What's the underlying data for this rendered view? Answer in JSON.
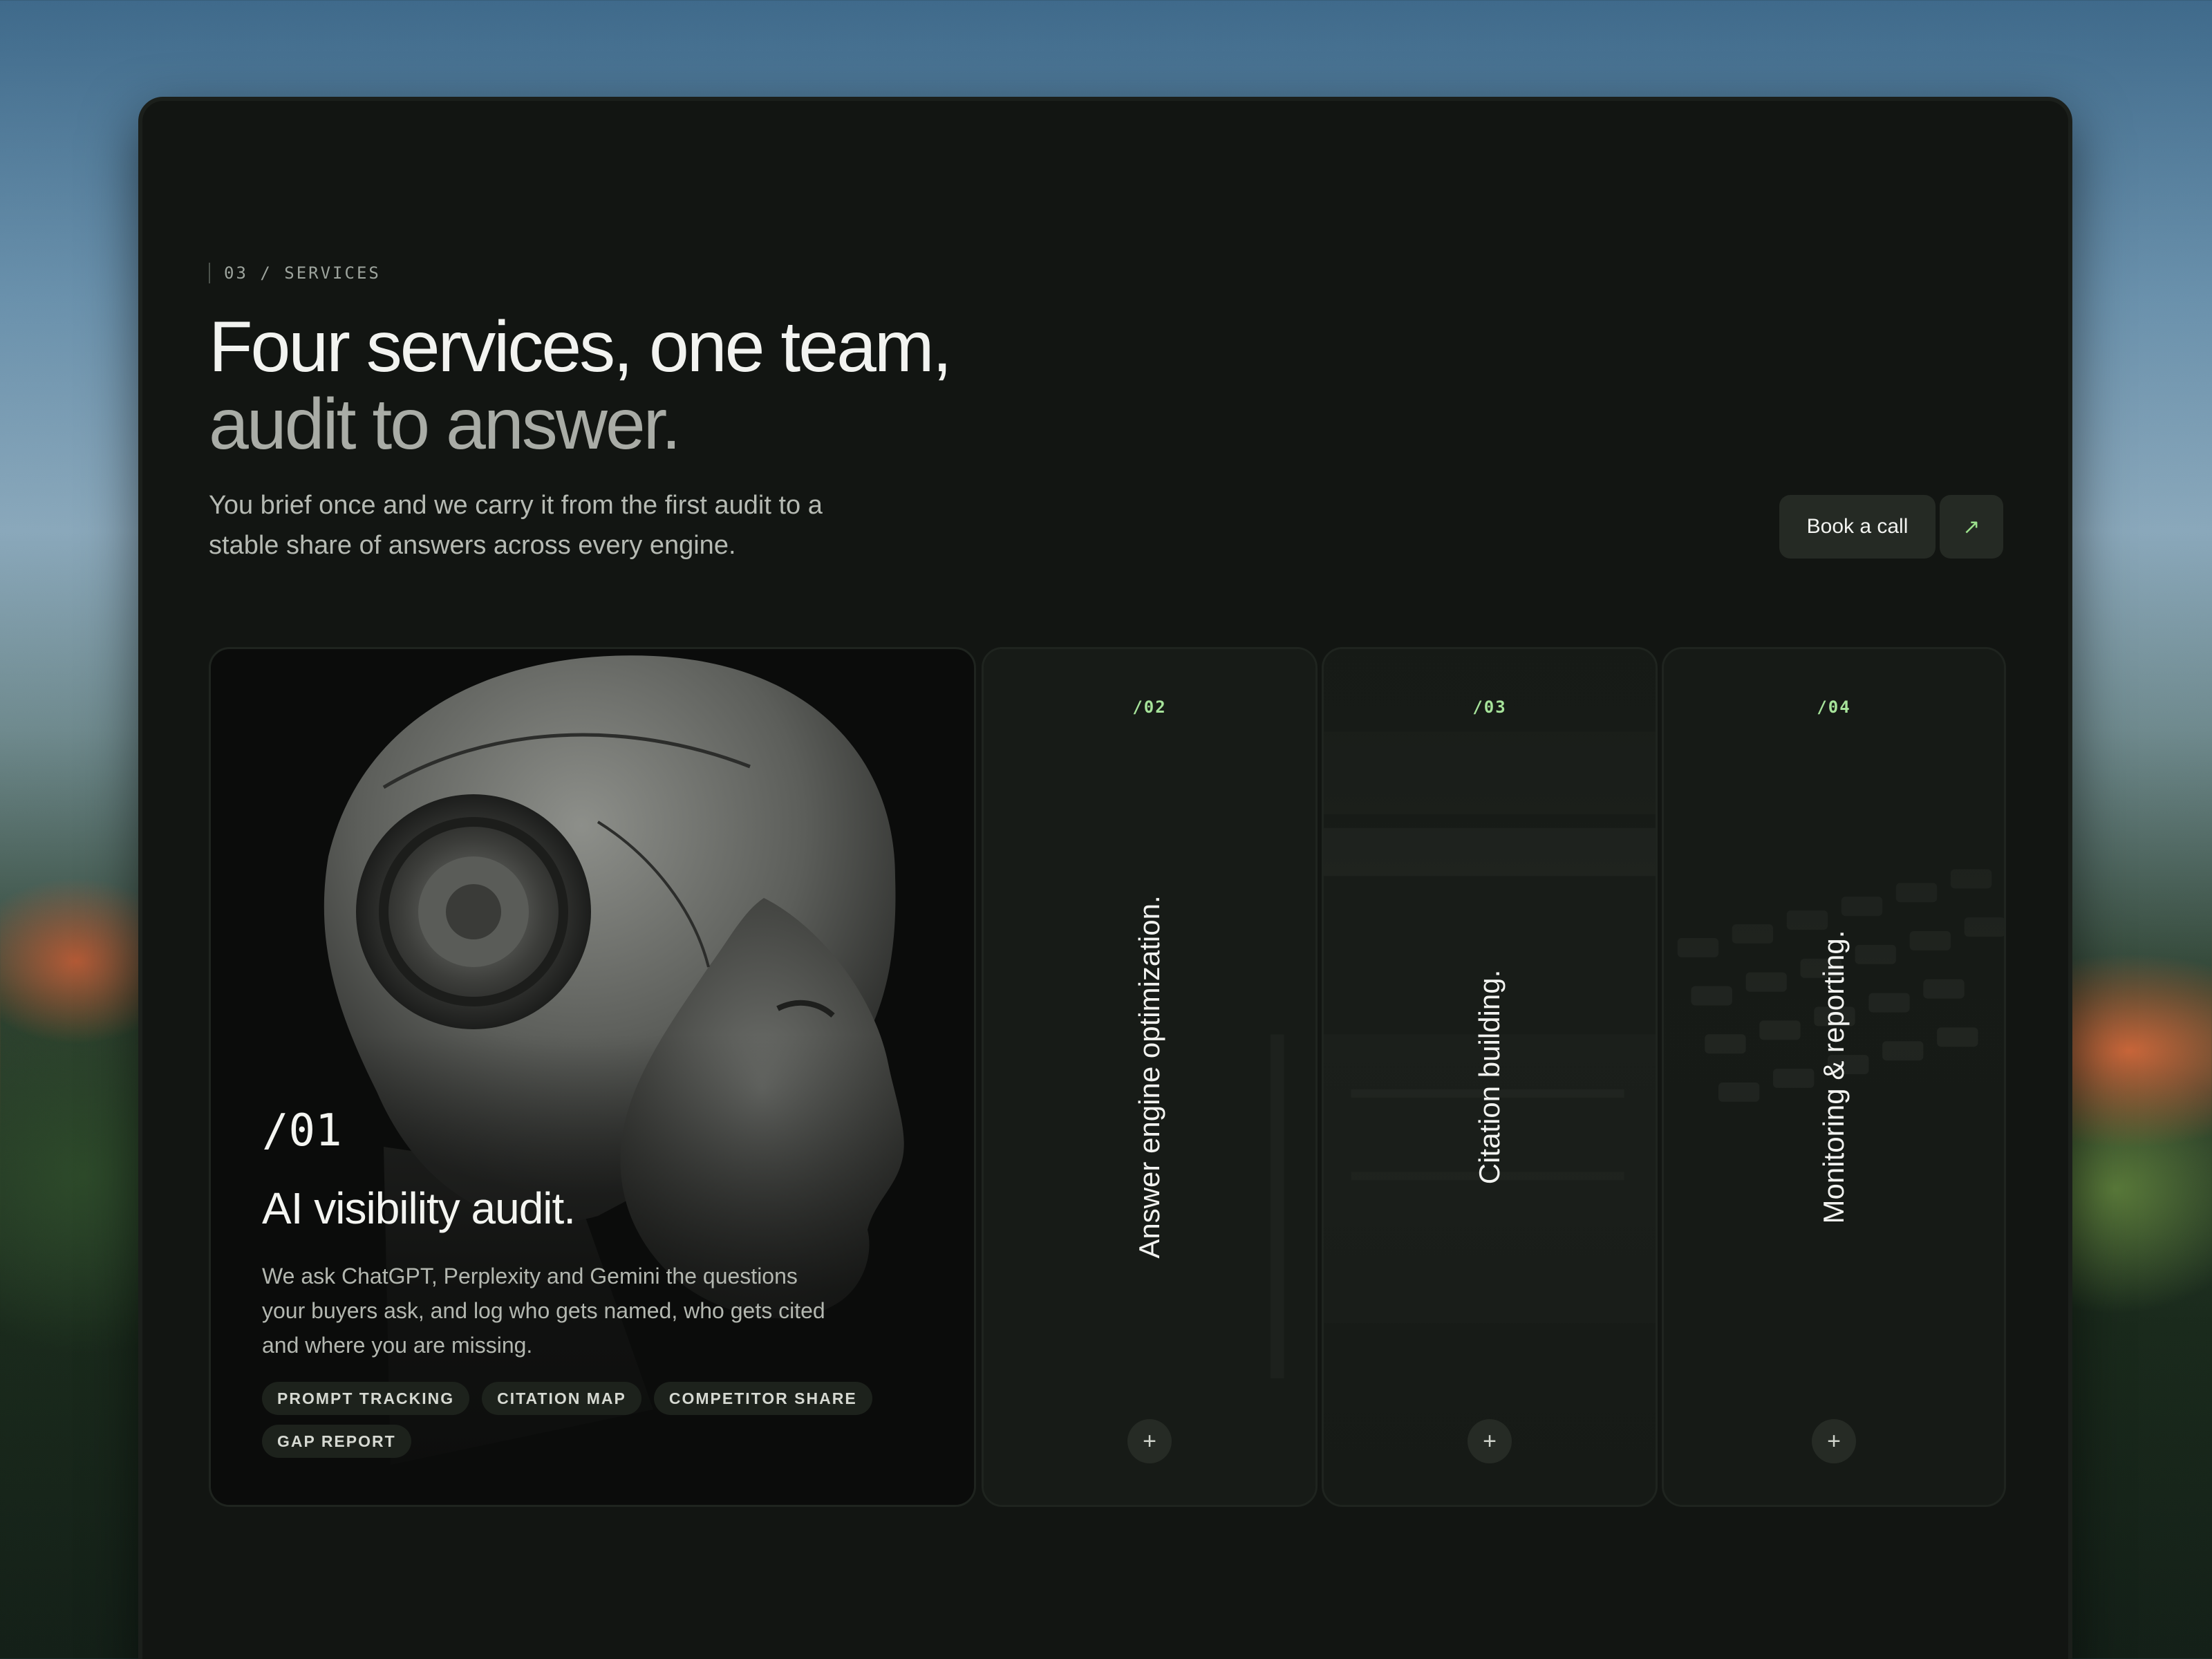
{
  "section": {
    "eyebrow": "03 / SERVICES",
    "headline_line1": "Four services, one team,",
    "headline_line2": "audit to answer.",
    "intro": "You brief once and we carry it from the first audit to a stable share of answers across every engine."
  },
  "cta": {
    "label": "Book a call",
    "arrow": "↗"
  },
  "featured": {
    "number": "/01",
    "title": "AI visibility audit.",
    "description": "We ask ChatGPT, Perplexity and Gemini the questions your buyers ask, and log who gets named, who gets cited and where you are missing.",
    "tags": [
      "PROMPT TRACKING",
      "CITATION MAP",
      "COMPETITOR SHARE",
      "GAP REPORT"
    ]
  },
  "services": [
    {
      "number": "/02",
      "title": "Answer engine optimization.",
      "expand": "+"
    },
    {
      "number": "/03",
      "title": "Citation building.",
      "expand": "+"
    },
    {
      "number": "/04",
      "title": "Monitoring & reporting.",
      "expand": "+"
    }
  ],
  "colors": {
    "accent": "#a6e39a",
    "panel": "#121512",
    "card": "#161a16"
  }
}
